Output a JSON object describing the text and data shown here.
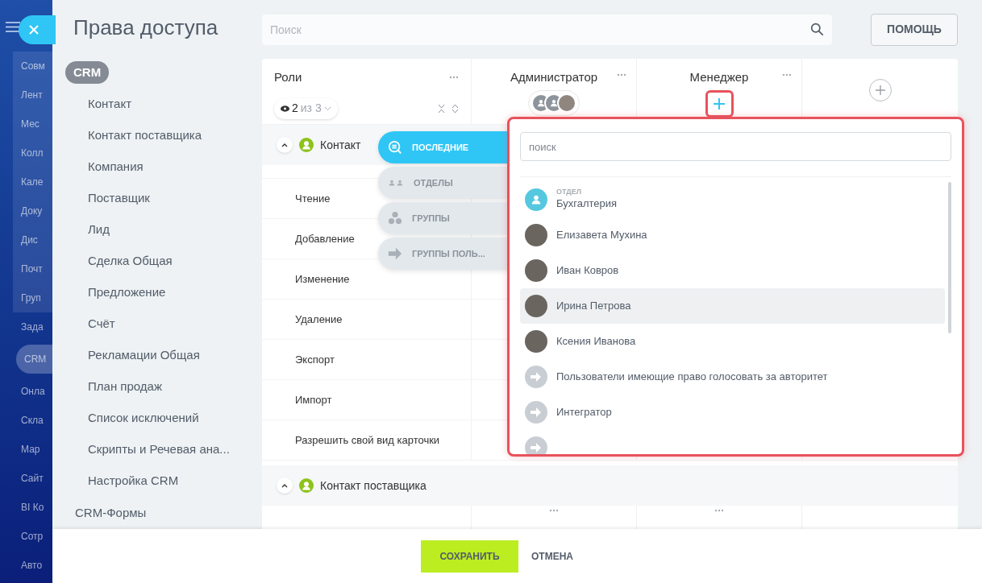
{
  "background_nav": {
    "items": [
      {
        "label": "Совм",
        "selected": false
      },
      {
        "label": "Лент",
        "selected": false
      },
      {
        "label": "Мес",
        "selected": false
      },
      {
        "label": "Колл",
        "selected": false
      },
      {
        "label": "Кале",
        "selected": false
      },
      {
        "label": "Доку",
        "selected": false
      },
      {
        "label": "Дис",
        "selected": false
      },
      {
        "label": "Почт",
        "selected": false
      },
      {
        "label": "Груп",
        "selected": false
      },
      {
        "label": "Зада",
        "selected": false
      },
      {
        "label": "CRM",
        "selected": true
      },
      {
        "label": "Онла",
        "selected": false
      },
      {
        "label": "Скла",
        "selected": false
      },
      {
        "label": "Мар",
        "selected": false
      },
      {
        "label": "Сайт",
        "selected": false
      },
      {
        "label": "BI Ко",
        "selected": false
      },
      {
        "label": "Сотр",
        "selected": false
      },
      {
        "label": "Авто",
        "selected": false
      }
    ]
  },
  "panel": {
    "title": "Права доступа",
    "search": {
      "placeholder": "Поиск"
    },
    "help_button": "ПОМОЩЬ"
  },
  "menu": [
    {
      "label": "CRM",
      "selected": true,
      "children": [
        {
          "label": "Контакт"
        },
        {
          "label": "Контакт поставщика"
        },
        {
          "label": "Компания"
        },
        {
          "label": "Поставщик"
        },
        {
          "label": "Лид"
        },
        {
          "label": "Сделка Общая"
        },
        {
          "label": "Предложение"
        },
        {
          "label": "Счёт"
        },
        {
          "label": "Рекламации Общая"
        },
        {
          "label": "План продаж"
        },
        {
          "label": "Список исключений"
        },
        {
          "label": "Скрипты и Речевая ана..."
        },
        {
          "label": "Настройка CRM"
        }
      ]
    },
    {
      "label": "CRM-Формы",
      "selected": false
    }
  ],
  "table": {
    "roles_title": "Роли",
    "filter_count": "2",
    "filter_total": "из 3",
    "columns": [
      {
        "title": "Администратор",
        "kind": "avatars"
      },
      {
        "title": "Менеджер",
        "kind": "add"
      },
      {
        "kind": "new"
      }
    ],
    "sections": [
      {
        "title": "Контакт",
        "expanded": true,
        "rows": [
          "Чтение",
          "Добавление",
          "Изменение",
          "Удаление",
          "Экспорт",
          "Импорт",
          "Разрешить свой вид карточки"
        ]
      },
      {
        "title": "Контакт поставщика",
        "expanded": true,
        "rows": [
          ""
        ]
      }
    ]
  },
  "source_tabs": [
    {
      "label": "ПОСЛЕДНИЕ",
      "kind": "recent",
      "selected": true
    },
    {
      "label": "ОТДЕЛЫ",
      "kind": "departments",
      "selected": false
    },
    {
      "label": "ГРУППЫ",
      "kind": "groups",
      "selected": false
    },
    {
      "label": "ГРУППЫ ПОЛЬ...",
      "kind": "usergroups",
      "selected": false
    }
  ],
  "picker": {
    "search": {
      "placeholder": "поиск"
    },
    "items": [
      {
        "kind": "department",
        "caption": "ОТДЕЛ",
        "name": "Бухгалтерия",
        "selected": false
      },
      {
        "kind": "person",
        "name": "Елизавета Мухина",
        "selected": false
      },
      {
        "kind": "person",
        "name": "Иван Ковров",
        "selected": false
      },
      {
        "kind": "person",
        "name": "Ирина Петрова",
        "selected": true
      },
      {
        "kind": "person",
        "name": "Ксения Иванова",
        "selected": false
      },
      {
        "kind": "group",
        "name": "Пользователи имеющие право голосовать за авторитет",
        "selected": false
      },
      {
        "kind": "group",
        "name": "Интегратор",
        "selected": false
      }
    ]
  },
  "footer": {
    "save": "СОХРАНИТЬ",
    "cancel": "ОТМЕНА"
  }
}
